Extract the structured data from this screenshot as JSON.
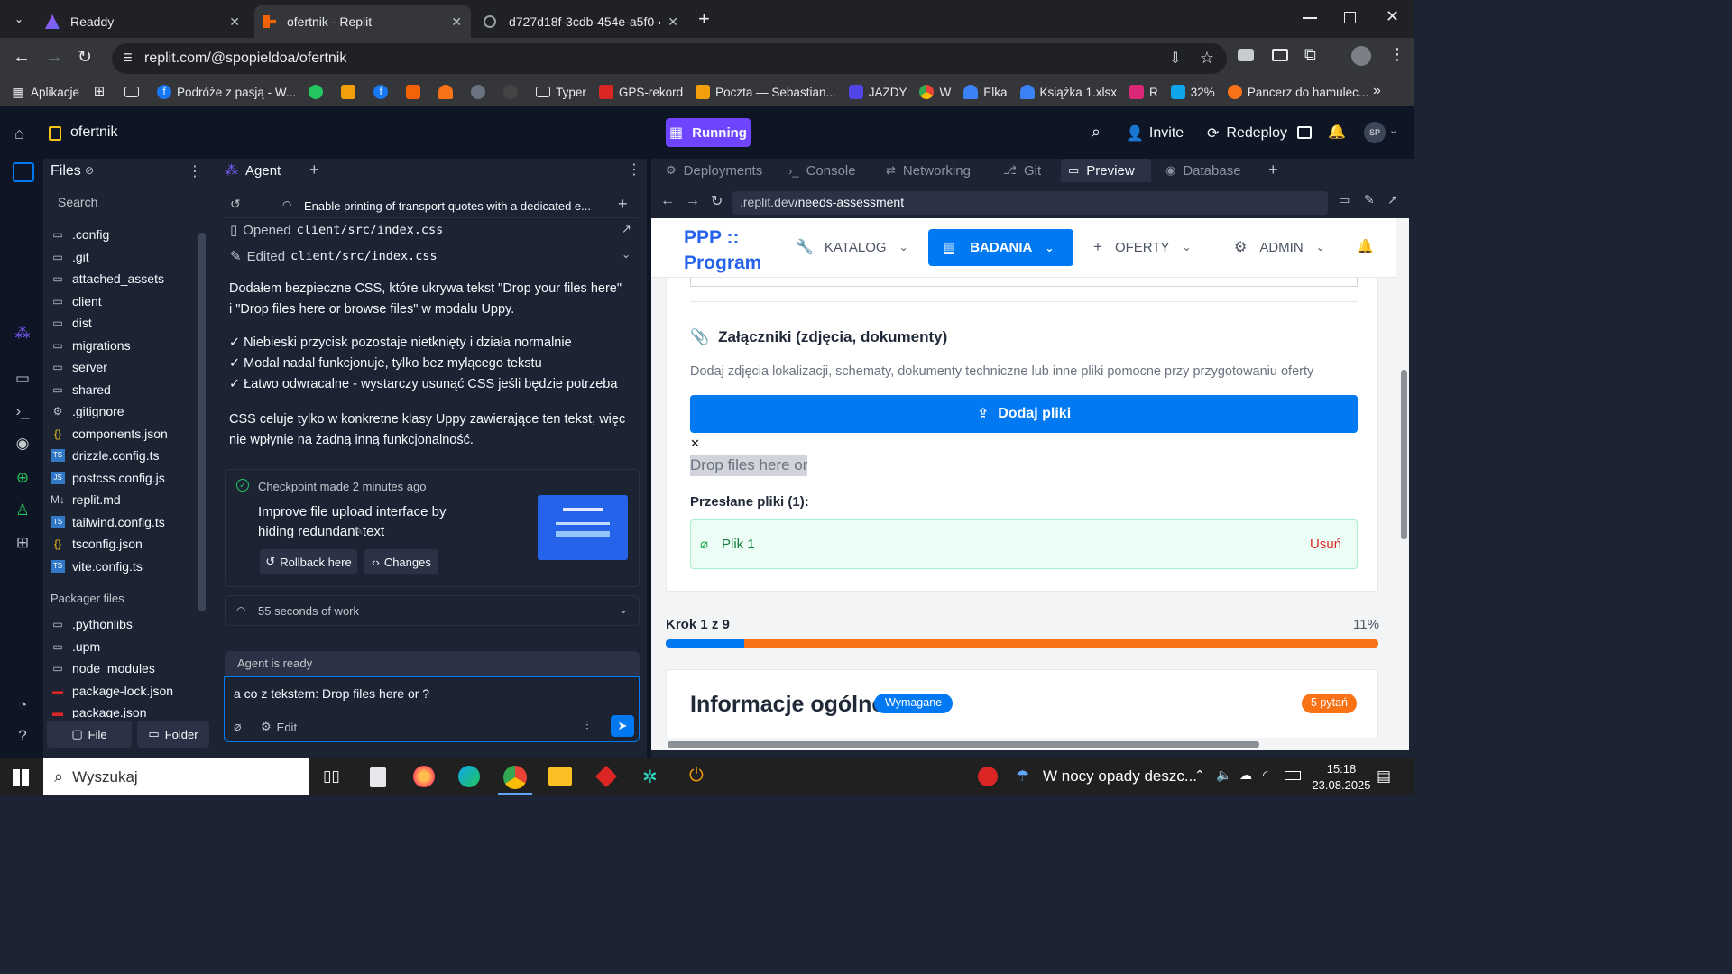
{
  "browser": {
    "tabs": [
      {
        "title": "Readdy",
        "close": "✕"
      },
      {
        "title": "ofertnik - Replit",
        "close": "✕"
      },
      {
        "title": "d727d18f-3cdb-454e-a5f0-4ad",
        "close": "✕"
      }
    ],
    "new_tab": "+",
    "url": "replit.com/@spopieldoa/ofertnik",
    "bookmarks": [
      "Aplikacje",
      "Podróże z pasją - W...",
      "Typer",
      "GPS-rekord",
      "Poczta — Sebastian...",
      "JAZDY",
      "W",
      "Elka",
      "Książka 1.xlsx",
      "R",
      "32%",
      "Pancerz do hamulec..."
    ]
  },
  "replit": {
    "project": "ofertnik",
    "run_status": "Running",
    "invite": "Invite",
    "redeploy": "Redeploy",
    "avatar": "SP",
    "files_title": "Files",
    "search_placeholder": "Search",
    "files": [
      ".config",
      ".git",
      "attached_assets",
      "client",
      "dist",
      "migrations",
      "server",
      "shared",
      ".gitignore",
      "components.json",
      "drizzle.config.ts",
      "postcss.config.js",
      "replit.md",
      "tailwind.config.ts",
      "tsconfig.json",
      "vite.config.ts"
    ],
    "file_icons": [
      "folder",
      "folder",
      "folder",
      "folder",
      "folder",
      "folder",
      "folder",
      "folder",
      "gear",
      "json",
      "ts",
      "js",
      "md",
      "ts",
      "json",
      "ts"
    ],
    "packager_title": "Packager files",
    "packager_files": [
      ".pythonlibs",
      ".upm",
      "node_modules",
      "package-lock.json",
      "package.json"
    ],
    "new_file": "File",
    "new_folder": "Folder",
    "agent_tab": "Agent",
    "agent_header": "Enable printing of transport quotes with a dedicated e...",
    "opened_label": "Opened",
    "opened_file": "client/src/index.css",
    "edited_label": "Edited",
    "edited_file": "client/src/index.css",
    "msg_p1": "Dodałem bezpieczne CSS, które ukrywa tekst \"Drop your files here\" i \"Drop files here or browse files\" w modalu Uppy.",
    "msg_b1": "✓ Niebieski przycisk pozostaje nietknięty i działa normalnie",
    "msg_b2": "✓ Modal nadal funkcjonuje, tylko bez mylącego tekstu",
    "msg_b3": "✓ Łatwo odwracalne - wystarczy usunąć CSS jeśli będzie potrzeba",
    "msg_p2": "CSS celuje tylko w konkretne klasy Uppy zawierające ten tekst, więc nie wpłynie na żadną inną funkcjonalność.",
    "checkpoint": "Checkpoint made",
    "checkpoint_time": "2 minutes ago",
    "checkpoint_title": "Improve file upload interface by hiding redundant text",
    "rollback": "Rollback here",
    "changes": "Changes",
    "work_time": "55 seconds of work",
    "agent_status": "Agent is ready",
    "input_value": "a co z tekstem: Drop files here or ?",
    "edit_label": "Edit",
    "tabs": [
      "Deployments",
      "Console",
      "Networking",
      "Git",
      "Preview",
      "Database"
    ],
    "preview_url_prefix": ".replit.dev",
    "preview_url_path": "/needs-assessment"
  },
  "app": {
    "brand": "PPP :: Program",
    "nav": [
      "KATALOG",
      "BADANIA",
      "OFERTY",
      "ADMIN"
    ],
    "attach_title": "Załączniki (zdjęcia, dokumenty)",
    "attach_desc": "Dodaj zdjęcia lokalizacji, schematy, dokumenty techniczne lub inne pliki pomocne przy przygotowaniu oferty",
    "add_files": "Dodaj pliki",
    "close_x": "✕",
    "drop_text": "Drop files here or",
    "uploaded_label": "Przesłane pliki (1):",
    "file1": "Plik 1",
    "remove": "Usuń",
    "step": "Krok 1 z 9",
    "progress_pct": "11%",
    "progress_value": 0.11,
    "section_title": "Informacje ogólne",
    "required": "Wymagane",
    "questions": "5 pytań"
  },
  "taskbar": {
    "search": "Wyszukaj",
    "weather": "W nocy opady deszc...",
    "time": "15:18",
    "date": "23.08.2025"
  },
  "colors": {
    "accent": "#0079f2",
    "orange": "#f97316",
    "running": "#6e44ff"
  }
}
